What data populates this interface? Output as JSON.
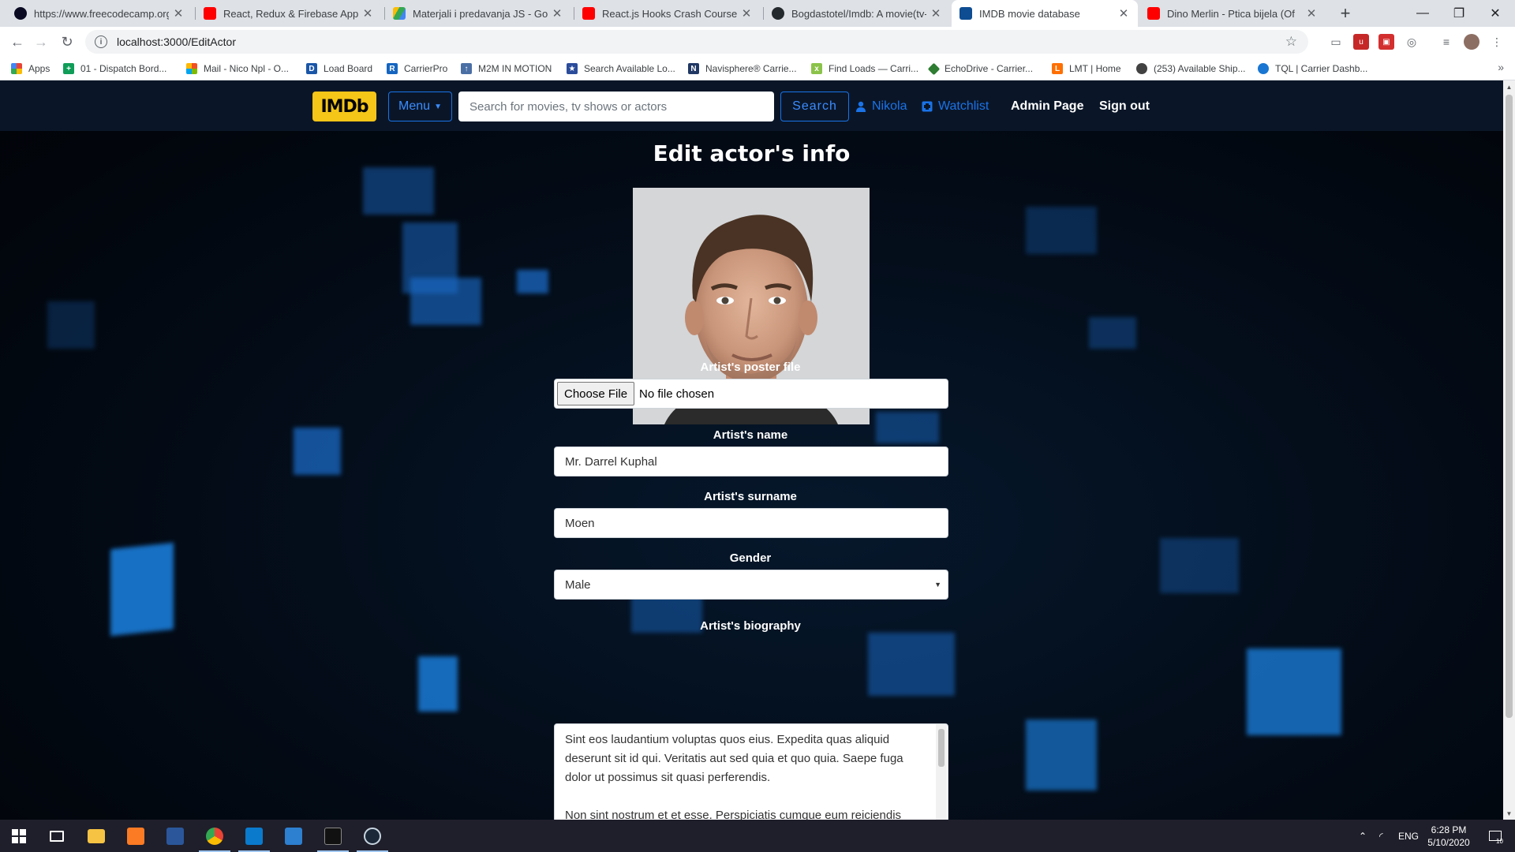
{
  "browser": {
    "tabs": [
      {
        "label": "https://www.freecodecamp.org/l",
        "color": "#0a0a23"
      },
      {
        "label": "React, Redux & Firebase App Tut",
        "color": "#ff0000"
      },
      {
        "label": "Materjali i predavanja JS - Googl",
        "color": "#34a853"
      },
      {
        "label": "React.js Hooks Crash Course - Yo",
        "color": "#ff0000"
      },
      {
        "label": "Bogdastotel/Imdb: A movie(tv-sh",
        "color": "#24292e"
      },
      {
        "label": "IMDB movie database",
        "color": "#0e4d92"
      },
      {
        "label": "Dino Merlin - Ptica bijela (Of",
        "color": "#ff0000"
      }
    ],
    "url": "localhost:3000/EditActor",
    "bookmarks": [
      {
        "label": "Apps",
        "color": "#ea4335"
      },
      {
        "label": "01 - Dispatch Bord...",
        "color": "#0f9d58"
      },
      {
        "label": "Mail - Nico Npl - O...",
        "color": "#f25022"
      },
      {
        "label": "Load Board",
        "color": "#1a56a8"
      },
      {
        "label": "CarrierPro",
        "color": "#1565c0"
      },
      {
        "label": "M2M IN MOTION",
        "color": "#4a6fa5"
      },
      {
        "label": "Search Available Lo...",
        "color": "#2b4c9b"
      },
      {
        "label": "Navisphere® Carrie...",
        "color": "#203864"
      },
      {
        "label": "Find Loads — Carri...",
        "color": "#8bc34a"
      },
      {
        "label": "EchoDrive - Carrier...",
        "color": "#2e7d32"
      },
      {
        "label": "LMT | Home",
        "color": "#ff6f00"
      },
      {
        "label": "(253) Available Ship...",
        "color": "#424242"
      },
      {
        "label": "TQL | Carrier Dashb...",
        "color": "#1976d2"
      }
    ]
  },
  "site": {
    "logo": "IMDb",
    "menu_label": "Menu",
    "search_placeholder": "Search for movies, tv shows or actors",
    "search_button": "Search",
    "user_name": "Nikola",
    "watchlist": "Watchlist",
    "admin": "Admin Page",
    "signout": "Sign out"
  },
  "form": {
    "title": "Edit actor's info",
    "poster_label": "Artist's poster file",
    "file_button": "Choose File",
    "file_status": "No file chosen",
    "name_label": "Artist's name",
    "name_value": "Mr. Darrel Kuphal",
    "surname_label": "Artist's surname",
    "surname_value": "Moen",
    "gender_label": "Gender",
    "gender_value": "Male",
    "bio_label": "Artist's biography",
    "bio_p1": "Sint eos laudantium voluptas quos eius. Expedita quas aliquid deserunt sit id qui. Veritatis aut sed quia et quo quia. Saepe fuga dolor ut possimus sit quasi perferendis.",
    "bio_p2": "Non sint nostrum et et esse. Perspiciatis cumque eum reiciendis"
  },
  "taskbar": {
    "lang": "ENG",
    "time": "6:28 PM",
    "date": "5/10/2020",
    "notifications": "10"
  }
}
